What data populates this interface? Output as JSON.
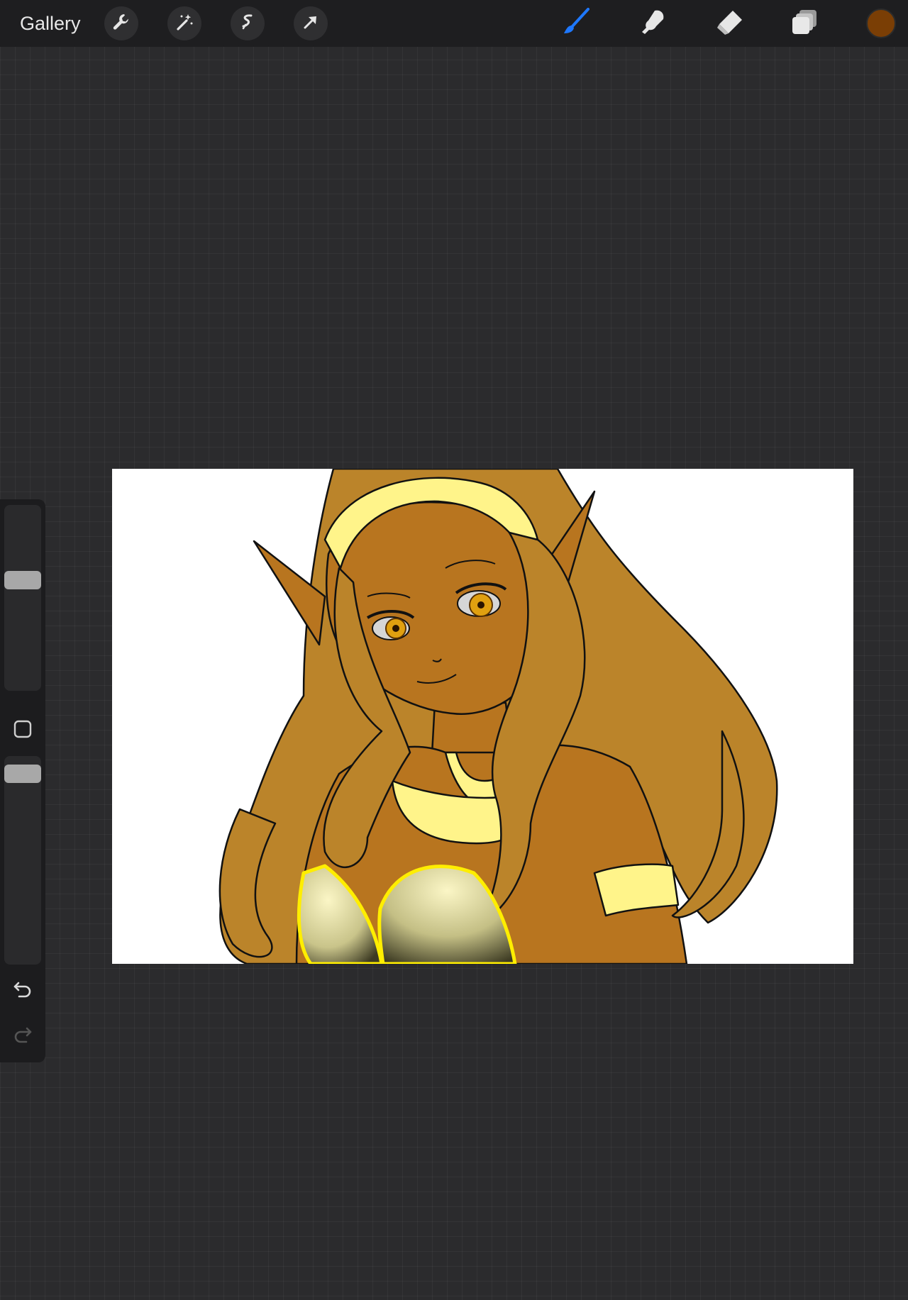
{
  "toolbar": {
    "gallery_label": "Gallery",
    "left_tools": [
      "wrench-icon",
      "magic-wand-icon",
      "selection-icon",
      "transform-arrow-icon"
    ],
    "right_tools": [
      "brush-icon",
      "smudge-icon",
      "eraser-icon",
      "layers-icon"
    ],
    "active_tool": "brush-icon",
    "active_color": "#7a3e05",
    "accent_color": "#1e78ff"
  },
  "sidebar": {
    "brush_size_level": 0.25,
    "opacity_level": 0.15,
    "controls": [
      "modify-square-icon",
      "undo-icon",
      "redo-icon"
    ]
  },
  "canvas": {
    "description_colors": {
      "hair": "#bb842a",
      "skin": "#b8751f",
      "accent": "#fff48a",
      "background": "#ffffff"
    }
  }
}
